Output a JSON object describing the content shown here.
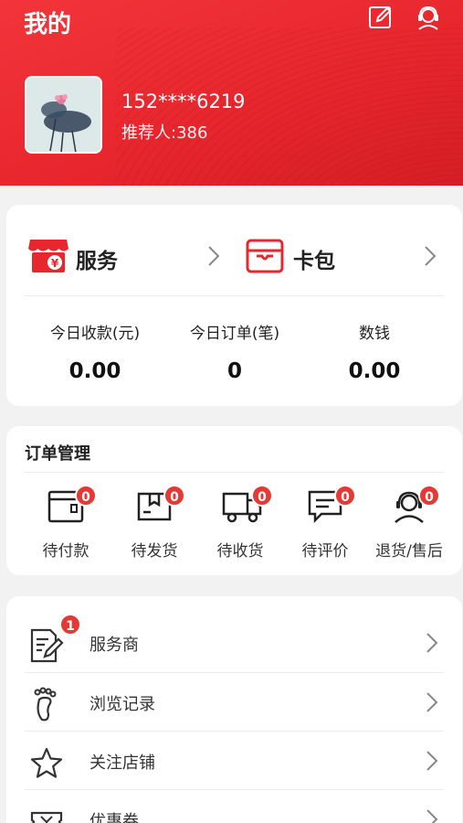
{
  "header": {
    "title": "我的",
    "phone": "152****6219",
    "referrer": "推荐人:386"
  },
  "services": {
    "service_label": "服务",
    "wallet_label": "卡包"
  },
  "stats": [
    {
      "label": "今日收款(元)",
      "value": "0.00"
    },
    {
      "label": "今日订单(笔)",
      "value": "0"
    },
    {
      "label": "数钱",
      "value": "0.00"
    }
  ],
  "orders": {
    "title": "订单管理",
    "items": [
      {
        "label": "待付款",
        "badge": "0",
        "icon": "wallet-icon"
      },
      {
        "label": "待发货",
        "badge": "0",
        "icon": "package-icon"
      },
      {
        "label": "待收货",
        "badge": "0",
        "icon": "truck-icon"
      },
      {
        "label": "待评价",
        "badge": "0",
        "icon": "comment-icon"
      },
      {
        "label": "退货/售后",
        "badge": "0",
        "icon": "support-icon"
      }
    ]
  },
  "menu": [
    {
      "label": "服务商",
      "badge": "1",
      "icon": "edit-doc-icon"
    },
    {
      "label": "浏览记录",
      "icon": "footprint-icon"
    },
    {
      "label": "关注店铺",
      "icon": "star-icon"
    },
    {
      "label": "优惠券",
      "icon": "coupon-icon"
    }
  ],
  "colors": {
    "brand_red": "#e8262d",
    "badge_red": "#e53935"
  }
}
